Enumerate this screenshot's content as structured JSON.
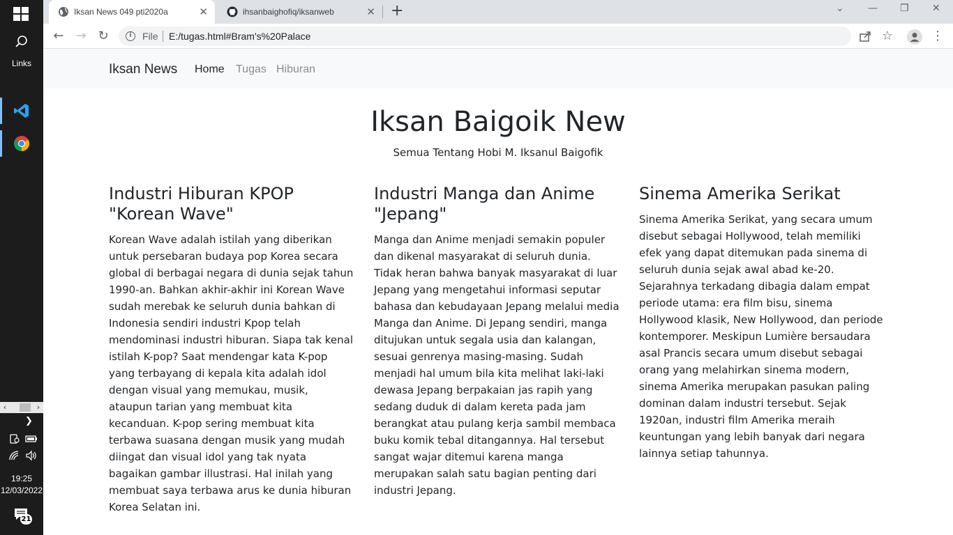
{
  "taskbar": {
    "links_label": "Links",
    "time": "19:25",
    "date": "12/03/2022",
    "notification_count": "21"
  },
  "browser": {
    "tabs": [
      {
        "title": "Iksan News 049 pti2020a",
        "icon": "globe-icon",
        "active": true
      },
      {
        "title": "ihsanbaighofiq/iksanweb",
        "icon": "github-icon",
        "active": false
      }
    ],
    "address": {
      "scheme_label": "File",
      "url": "E:/tugas.html#Bram's%20Palace"
    }
  },
  "navbar": {
    "brand": "Iksan News",
    "links": [
      "Home",
      "Tugas",
      "Hiburan"
    ]
  },
  "hero": {
    "title": "Iksan Baigoik New",
    "subtitle": "Semua Tentang Hobi M. Iksanul Baigofik"
  },
  "articles": [
    {
      "title": "Industri Hiburan KPOP \"Korean Wave\"",
      "body": "Korean Wave adalah istilah yang diberikan untuk persebaran budaya pop Korea secara global di berbagai negara di dunia sejak tahun 1990-an. Bahkan akhir-akhir ini Korean Wave sudah merebak ke seluruh dunia bahkan di Indonesia sendiri industri Kpop telah mendominasi industri hiburan. Siapa tak kenal istilah K-pop? Saat mendengar kata K-pop yang terbayang di kepala kita adalah idol dengan visual yang memukau, musik, ataupun tarian yang membuat kita kecanduan. K-pop sering membuat kita terbawa suasana dengan musik yang mudah diingat dan visual idol yang tak nyata bagaikan gambar illustrasi. Hal inilah yang membuat saya terbawa arus ke dunia hiburan Korea Selatan ini."
    },
    {
      "title": "Industri Manga dan Anime \"Jepang\"",
      "body": "Manga dan Anime menjadi semakin populer dan dikenal masyarakat di seluruh dunia. Tidak heran bahwa banyak masyarakat di luar Jepang yang mengetahui informasi seputar bahasa dan kebudayaan Jepang melalui media Manga dan Anime. Di Jepang sendiri, manga ditujukan untuk segala usia dan kalangan, sesuai genrenya masing-masing. Sudah menjadi hal umum bila kita melihat laki-laki dewasa Jepang berpakaian jas rapih yang sedang duduk di dalam kereta pada jam berangkat atau pulang kerja sambil membaca buku komik tebal ditangannya. Hal tersebut sangat wajar ditemui karena manga merupakan salah satu bagian penting dari industri Jepang."
    },
    {
      "title": "Sinema Amerika Serikat",
      "body": "Sinema Amerika Serikat, yang secara umum disebut sebagai Hollywood, telah memiliki efek yang dapat ditemukan pada sinema di seluruh dunia sejak awal abad ke-20. Sejarahnya terkadang dibagia dalam empat periode utama: era film bisu, sinema Hollywood klasik, New Hollywood, dan periode kontemporer. Meskipun Lumière bersaudara asal Prancis secara umum disebut sebagai orang yang melahirkan sinema modern, sinema Amerika merupakan pasukan paling dominan dalam industri tersebut. Sejak 1920an, industri film Amerika meraih keuntungan yang lebih banyak dari negara lainnya setiap tahunnya."
    }
  ]
}
